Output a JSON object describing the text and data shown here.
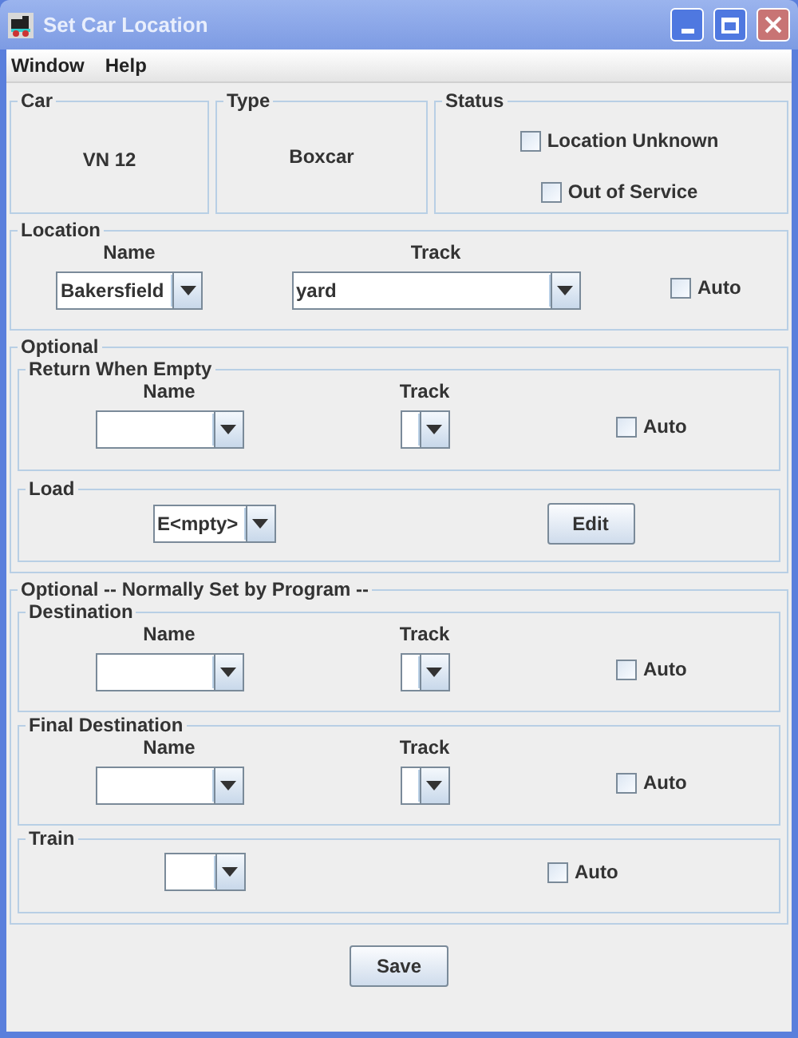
{
  "window": {
    "title": "Set Car Location"
  },
  "menu": [
    "Window",
    "Help"
  ],
  "car": {
    "label": "Car",
    "value": "VN 12"
  },
  "type": {
    "label": "Type",
    "value": "Boxcar"
  },
  "status": {
    "label": "Status",
    "options": [
      {
        "label": "Location Unknown",
        "checked": false
      },
      {
        "label": "Out of Service",
        "checked": false
      }
    ]
  },
  "location": {
    "label": "Location",
    "name_label": "Name",
    "name_value": "Bakersfield",
    "track_label": "Track",
    "track_value": "yard",
    "auto": {
      "label": "Auto",
      "checked": false
    }
  },
  "optional": {
    "label": "Optional",
    "return_when_empty": {
      "label": "Return When Empty",
      "name_label": "Name",
      "track_label": "Track",
      "auto": {
        "label": "Auto",
        "checked": false
      }
    },
    "load": {
      "label": "Load",
      "value": "E<mpty>",
      "edit_button": "Edit"
    }
  },
  "optional_program": {
    "label": "Optional -- Normally Set by Program --",
    "destination": {
      "label": "Destination",
      "name_label": "Name",
      "track_label": "Track",
      "auto": {
        "label": "Auto",
        "checked": false
      }
    },
    "final_destination": {
      "label": "Final Destination",
      "name_label": "Name",
      "track_label": "Track",
      "auto": {
        "label": "Auto",
        "checked": false
      }
    },
    "train": {
      "label": "Train",
      "auto": {
        "label": "Auto",
        "checked": false
      }
    }
  },
  "save_button": "Save"
}
